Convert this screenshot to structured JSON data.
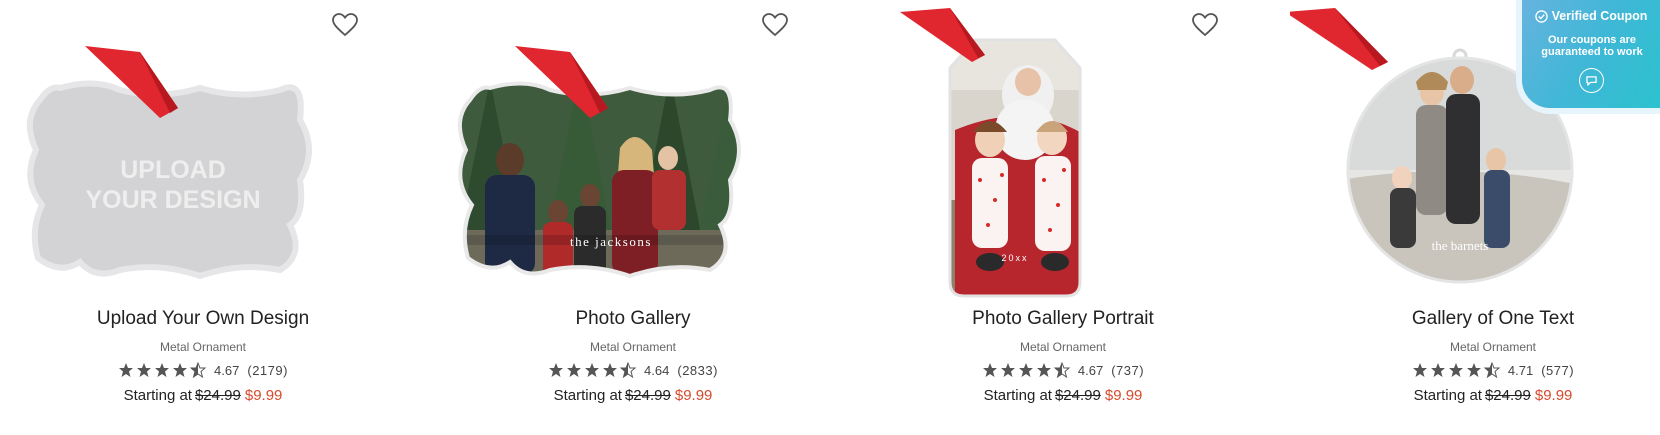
{
  "products": [
    {
      "name": "Upload Your Own Design",
      "type": "Metal Ornament",
      "rating": "4.67",
      "reviews": "(2179)",
      "price_prefix": "Starting at",
      "original_price": "$24.99",
      "sale_price": "$9.99",
      "stars": 4.5,
      "art_text_line1": "UPLOAD",
      "art_text_line2": "YOUR DESIGN",
      "shape": "bracket"
    },
    {
      "name": "Photo Gallery",
      "type": "Metal Ornament",
      "rating": "4.64",
      "reviews": "(2833)",
      "price_prefix": "Starting at",
      "original_price": "$24.99",
      "sale_price": "$9.99",
      "stars": 4.5,
      "photo_caption": "the jacksons",
      "shape": "bracket"
    },
    {
      "name": "Photo Gallery Portrait",
      "type": "Metal Ornament",
      "rating": "4.67",
      "reviews": "(737)",
      "price_prefix": "Starting at",
      "original_price": "$24.99",
      "sale_price": "$9.99",
      "stars": 4.5,
      "photo_caption": "20xx",
      "shape": "tag"
    },
    {
      "name": "Gallery of One Text",
      "type": "Metal Ornament",
      "rating": "4.71",
      "reviews": "(577)",
      "price_prefix": "Starting at",
      "original_price": "$24.99",
      "sale_price": "$9.99",
      "stars": 4.5,
      "photo_caption": "the barnets",
      "shape": "round"
    }
  ],
  "coupon": {
    "title": "Verified Coupon",
    "message": "Our coupons are guaranteed to work"
  },
  "icons": {
    "favorite": "heart-outline-icon",
    "star": "star-icon",
    "check": "check-circle-icon",
    "chat": "chat-bubble-icon"
  },
  "colors": {
    "sale": "#d64a2c",
    "ribbon": "#e0262f",
    "star": "#555555",
    "coupon": "#3fb7d6"
  }
}
